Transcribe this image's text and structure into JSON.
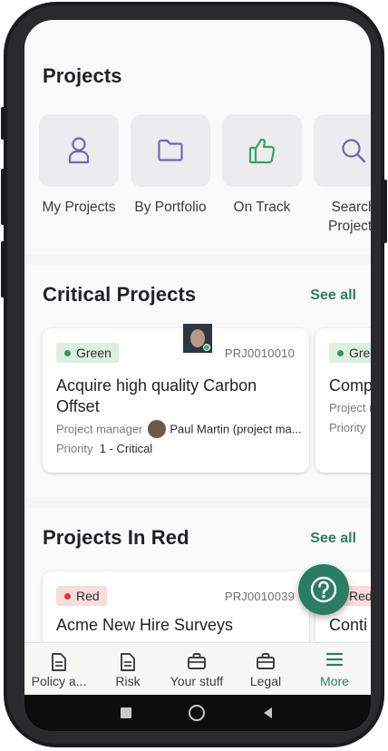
{
  "projects_section": {
    "title": "Projects",
    "quick_actions": [
      {
        "label": "My Projects",
        "icon": "person-icon"
      },
      {
        "label": "By Portfolio",
        "icon": "folder-icon"
      },
      {
        "label": "On Track",
        "icon": "thumbs-up-icon"
      },
      {
        "label": "Search\nProjects",
        "icon": "search-icon"
      }
    ]
  },
  "critical_section": {
    "title": "Critical Projects",
    "see_all": "See all",
    "cards": [
      {
        "status": "Green",
        "number": "PRJ0010010",
        "title": "Acquire high quality Carbon Offset",
        "manager_label": "Project manager",
        "manager_name": "Paul Martin (project ma...",
        "priority_label": "Priority",
        "priority_value": "1 - Critical"
      },
      {
        "status": "Gre",
        "title": "Comp",
        "manager_label": "Project m",
        "priority_label": "Priority"
      }
    ]
  },
  "red_section": {
    "title": "Projects In Red",
    "see_all": "See all",
    "cards": [
      {
        "status": "Red",
        "number": "PRJ0010039",
        "title": "Acme New Hire Surveys"
      },
      {
        "status": "Red",
        "title": "Conti"
      }
    ]
  },
  "tabbar": {
    "tabs": [
      {
        "label": "Policy a...",
        "icon": "document-icon",
        "active": false
      },
      {
        "label": "Risk",
        "icon": "document-icon",
        "active": false
      },
      {
        "label": "Your stuff",
        "icon": "briefcase-icon",
        "active": false
      },
      {
        "label": "Legal",
        "icon": "briefcase-icon",
        "active": false
      },
      {
        "label": "More",
        "icon": "menu-icon",
        "active": true
      }
    ]
  },
  "colors": {
    "accent": "#2e7d5f",
    "icon_purple": "#6c69b8",
    "icon_green": "#3aa06e",
    "status_green": "#3a9560",
    "status_red": "#d93b3b"
  }
}
